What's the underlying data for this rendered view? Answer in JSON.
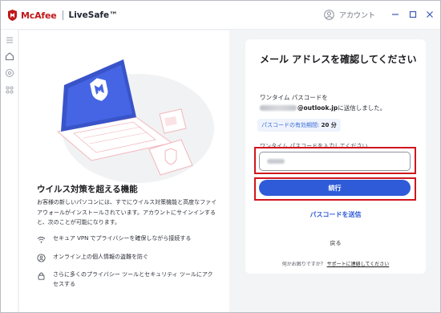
{
  "titlebar": {
    "brand": "McAfee",
    "product": "LiveSafe™",
    "account_label": "アカウント"
  },
  "sidebar": {
    "items": [
      "menu-icon",
      "home-icon",
      "security-icon",
      "apps-icon"
    ]
  },
  "left_panel": {
    "title": "ウイルス対策を超える機能",
    "description": "お客様の新しいパソコンには、すでにウイルス対策機能と高度なファイアウォールがインストールされています。アカウントにサインインすると、次のことが可能になります。",
    "features": [
      {
        "icon": "wifi-icon",
        "text": "セキュア VPN でプライバシーを確保しながら接続する"
      },
      {
        "icon": "identity-icon",
        "text": "オンライン上の個人情報の盗難を防ぐ"
      },
      {
        "icon": "lock-icon",
        "text": "さらに多くのプライバシー ツールとセキュリティ ツールにアクセスする"
      }
    ]
  },
  "card": {
    "title": "メール アドレスを確認してください",
    "code_sent_label": "ワンタイム パスコードを",
    "email_domain": "@outlook.jp",
    "email_suffix": " に送信しました。",
    "expiry_label": "パスコードの有効期間: ",
    "expiry_value": "20 分",
    "input_label": "ワンタイム パスコードを入力してください",
    "continue_label": "続行",
    "resend_label": "パスコードを送信",
    "back_label": "戻る",
    "help_prefix": "何かお困りですか？ ",
    "help_link": "サポートに連絡してください"
  },
  "colors": {
    "brand_red": "#c01818",
    "accent_blue": "#2f5bd8",
    "highlight_red": "#d0161e"
  }
}
